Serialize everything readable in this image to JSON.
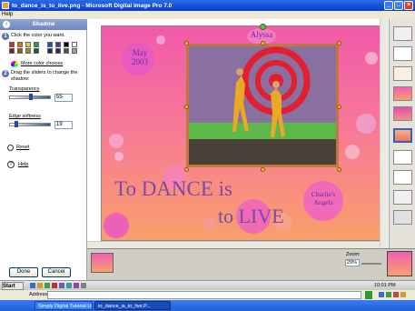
{
  "window": {
    "title": "to_dance_is_to_live.png - Microsoft Digital Image Pro 7.0"
  },
  "menu": {
    "help": "Help"
  },
  "panel": {
    "title": "Shadow",
    "step1": "Click the color you want.",
    "step2": "Drag the sliders to change the shadow:",
    "more_colors": "More color choices",
    "transparency_label": "Transparency",
    "transparency_value": "55",
    "edge_label": "Edge softness",
    "edge_value": "19",
    "reset": "Reset",
    "help": "Help",
    "done": "Done",
    "cancel": "Cancel",
    "swatches_row1": [
      "#e8241c",
      "#e86a18",
      "#f0d020",
      "#28a038",
      "#2050c0",
      "#6030a0",
      "#000000",
      "#ffffff"
    ],
    "swatches_row2": [
      "#882010",
      "#a05010",
      "#a09010",
      "#186020",
      "#102878",
      "#401870",
      "#505050",
      "#a0a0a0"
    ]
  },
  "photo": {
    "name_tag": "Alyssa",
    "date_line1": "May",
    "date_line2": "2003",
    "title_line1": "To DANCE is",
    "title_line2": "to LIVE",
    "charlies_line1": "Charlie's",
    "charlies_line2": "Angels"
  },
  "zoom": {
    "label": "Zoom:",
    "value": "29%"
  },
  "address": {
    "label": "Address"
  },
  "startbar": {
    "start": "Start",
    "time": "10:01 PM"
  },
  "taskbar": {
    "task1": "Simply Digital Tutorial Usin...",
    "task2": "to_dance_is_to_live.P..."
  }
}
